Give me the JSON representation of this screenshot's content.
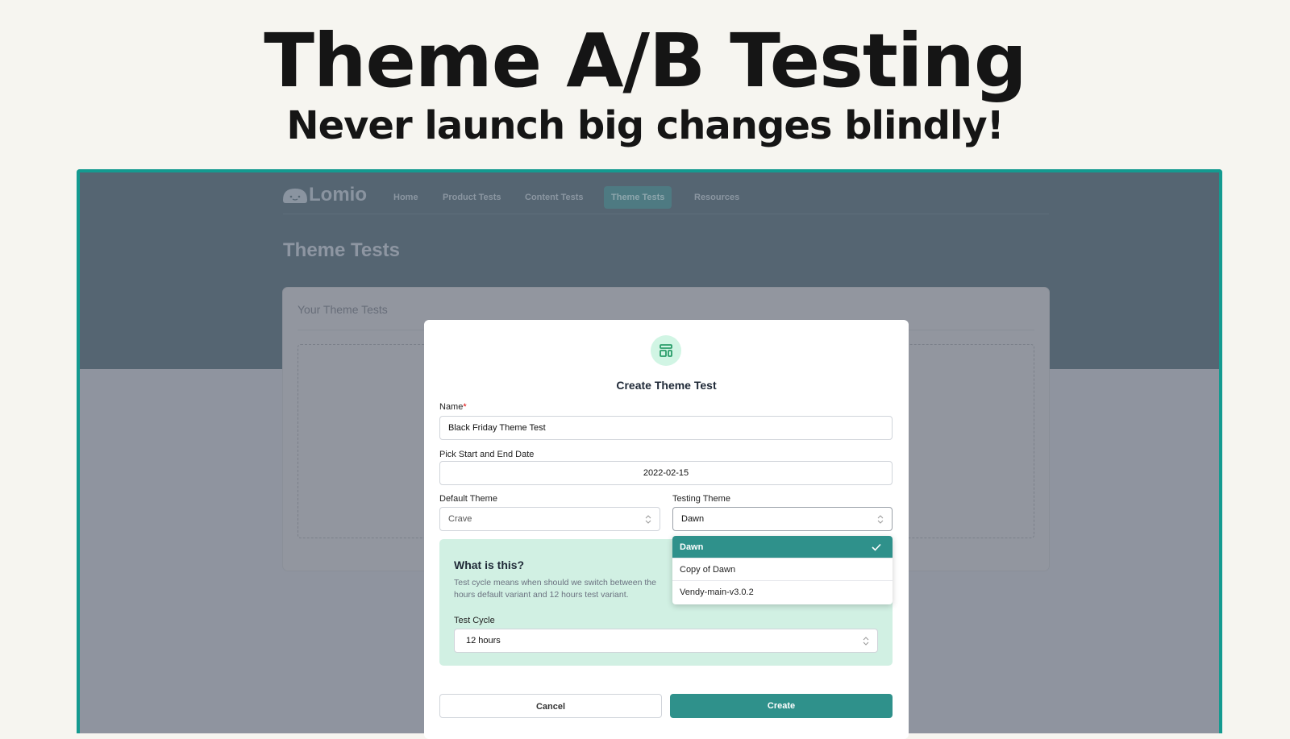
{
  "hero": {
    "title": "Theme A/B Testing",
    "subtitle": "Never launch big changes blindly!"
  },
  "app": {
    "logo": "Lomio",
    "nav": [
      {
        "label": "Home"
      },
      {
        "label": "Product Tests"
      },
      {
        "label": "Content Tests"
      },
      {
        "label": "Theme Tests",
        "active": true
      },
      {
        "label": "Resources"
      }
    ],
    "page_title": "Theme Tests",
    "card_title": "Your Theme Tests"
  },
  "modal": {
    "icon": "layout-icon",
    "title": "Create Theme Test",
    "name_label": "Name",
    "required_mark": "*",
    "name_value": "Black Friday Theme Test",
    "date_label": "Pick Start and End Date",
    "date_value": "2022-02-15",
    "default_label": "Default Theme",
    "default_value": "Crave",
    "testing_label": "Testing Theme",
    "testing_value": "Dawn",
    "options": [
      {
        "label": "Dawn",
        "selected": true
      },
      {
        "label": "Copy of Dawn"
      },
      {
        "label": "Vendy-main-v3.0.2"
      }
    ],
    "info_title": "What is this?",
    "info_text_1": "Test cycle means when should we switch between the",
    "info_text_2": "hours default variant and 12 hours test variant.",
    "cycle_label": "Test Cycle",
    "cycle_value": "12 hours",
    "cancel": "Cancel",
    "create": "Create"
  },
  "colors": {
    "accent": "#2f918b",
    "frame": "#149a90",
    "info_bg": "#d1f0e3"
  }
}
